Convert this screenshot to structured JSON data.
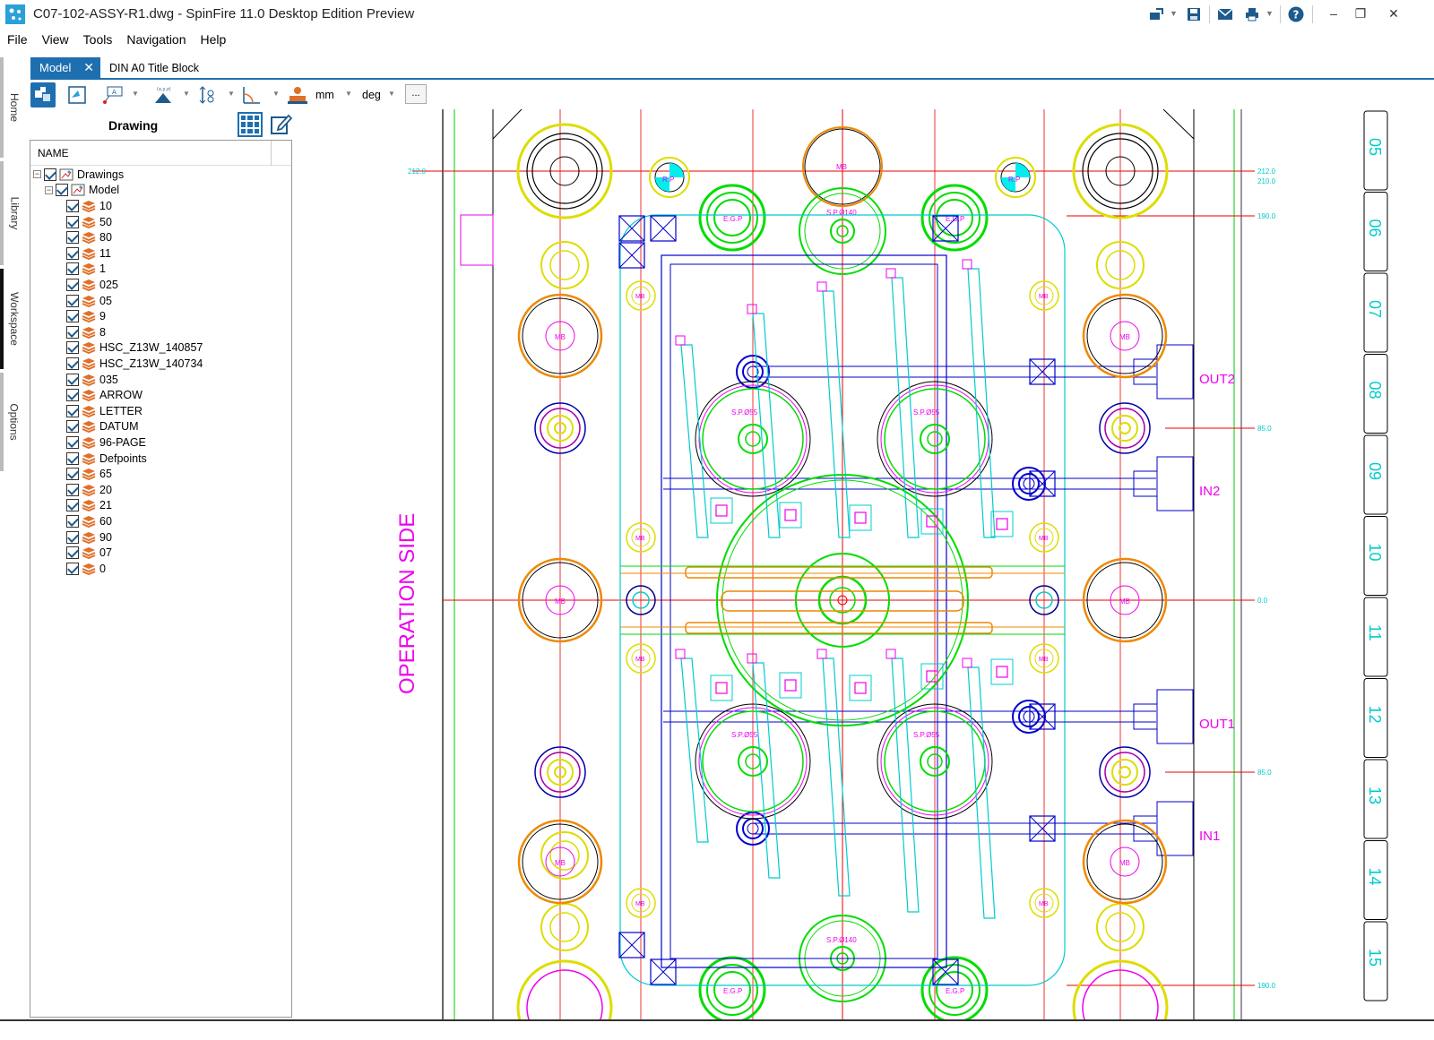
{
  "window": {
    "title": "C07-102-ASSY-R1.dwg - SpinFire 11.0 Desktop Edition Preview",
    "controls": [
      "–",
      "❐",
      "✕"
    ]
  },
  "menu": [
    "File",
    "View",
    "Tools",
    "Navigation",
    "Help"
  ],
  "rail_tabs": [
    "Home",
    "Library",
    "Workspace",
    "Options"
  ],
  "doc_tabs": {
    "model": "Model",
    "din": "DIN A0 Title Block"
  },
  "toolbar": {
    "unit_length": "mm",
    "unit_angle": "deg",
    "more": "..."
  },
  "panel": {
    "title": "Drawing",
    "column_name": "NAME",
    "root": "Drawings",
    "model": "Model",
    "layers": [
      "10",
      "50",
      "80",
      "11",
      "1",
      "025",
      "05",
      "9",
      "8",
      "HSC_Z13W_140857",
      "HSC_Z13W_140734",
      "035",
      "ARROW",
      "LETTER",
      "DATUM",
      "96-PAGE",
      "Defpoints",
      "65",
      "20",
      "21",
      "60",
      "90",
      "07",
      "0"
    ]
  },
  "drawing": {
    "side_label": "OPERATION SIDE",
    "ports": [
      "OUT2",
      "IN2",
      "OUT1",
      "IN1"
    ],
    "dims": [
      "212.0",
      "210.0",
      "190.0",
      "85.0",
      "0.0",
      "85.0",
      "190.0"
    ],
    "sheet_numbers": [
      "05",
      "06",
      "07",
      "08",
      "09",
      "10",
      "11",
      "12",
      "13",
      "14",
      "15"
    ],
    "small_labels": {
      "rp": "R.P",
      "egp": "E.G.P",
      "sp140": "S.P.Ø140",
      "sp55": "S.P.Ø55",
      "mb": "MB"
    }
  },
  "colors": {
    "accent": "#1e6fb0",
    "layer_icon": "#e0702a"
  }
}
